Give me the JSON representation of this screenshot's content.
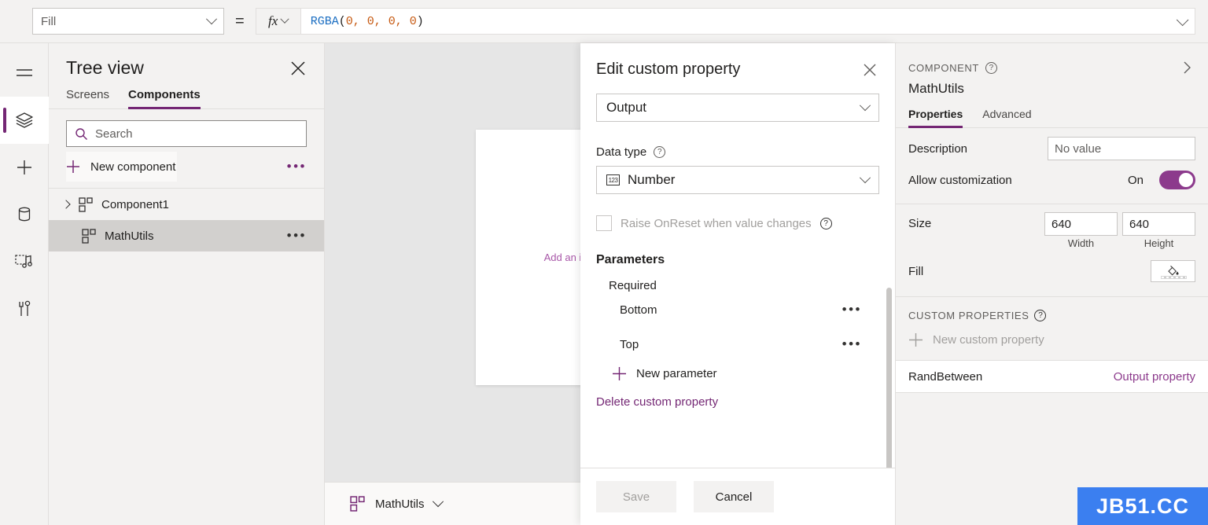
{
  "formula_bar": {
    "property_selected": "Fill",
    "equals": "=",
    "fx_label": "fx",
    "formula_parts": {
      "fn": "RGBA",
      "open": "(",
      "args": "0, 0, 0, 0",
      "close": ")"
    },
    "formula_full": "RGBA(0, 0, 0, 0)"
  },
  "rail": {
    "items": [
      {
        "icon": "hamburger-menu-icon",
        "active": false
      },
      {
        "icon": "layers-icon",
        "active": true
      },
      {
        "icon": "plus-icon",
        "active": false
      },
      {
        "icon": "database-icon",
        "active": false
      },
      {
        "icon": "media-icon",
        "active": false
      },
      {
        "icon": "tools-icon",
        "active": false
      }
    ]
  },
  "tree_view": {
    "title": "Tree view",
    "close_icon": "close-icon",
    "tabs": [
      {
        "label": "Screens",
        "active": false
      },
      {
        "label": "Components",
        "active": true
      }
    ],
    "search_placeholder": "Search",
    "search_value": "",
    "new_component_label": "New component",
    "items": [
      {
        "label": "Component1",
        "expandable": true,
        "selected": false,
        "has_overflow": false
      },
      {
        "label": "MathUtils",
        "expandable": false,
        "selected": true,
        "has_overflow": true
      }
    ]
  },
  "canvas": {
    "hint_text": "Add an item from the Insert",
    "statusbar": {
      "component_name": "MathUtils"
    }
  },
  "dialog": {
    "title": "Edit custom property",
    "close_icon": "close-icon",
    "property_type": "Output",
    "data_type_label": "Data type",
    "data_type_value": "Number",
    "data_type_icon": "123",
    "raise_onreset_label": "Raise OnReset when value changes",
    "raise_onreset_checked": false,
    "parameters_heading": "Parameters",
    "required_label": "Required",
    "parameters": [
      {
        "name": "Bottom"
      },
      {
        "name": "Top"
      }
    ],
    "new_parameter_label": "New parameter",
    "delete_label": "Delete custom property",
    "save_label": "Save",
    "save_disabled": true,
    "cancel_label": "Cancel"
  },
  "right_panel": {
    "kicker": "COMPONENT",
    "component_name": "MathUtils",
    "tabs": [
      {
        "label": "Properties",
        "active": true
      },
      {
        "label": "Advanced",
        "active": false
      }
    ],
    "description_label": "Description",
    "description_placeholder": "No value",
    "description_value": "",
    "allow_customization_label": "Allow customization",
    "allow_customization_state": "On",
    "size_label": "Size",
    "size_width": "640",
    "size_height": "640",
    "width_caption": "Width",
    "height_caption": "Height",
    "fill_label": "Fill",
    "custom_properties_kicker": "CUSTOM PROPERTIES",
    "new_custom_property_label": "New custom property",
    "custom_properties": [
      {
        "name": "RandBetween",
        "kind": "Output property"
      }
    ]
  },
  "watermark": {
    "text": "JB51.CC",
    "color": "#3b7ff0"
  },
  "colors": {
    "accent_purple": "#742774",
    "toggle_purple": "#8c3a8c",
    "formula_fn": "#1b6ec2",
    "formula_num": "#c65911",
    "panel_bg": "#f3f2f1",
    "canvas_bg": "#e6e6e6"
  }
}
